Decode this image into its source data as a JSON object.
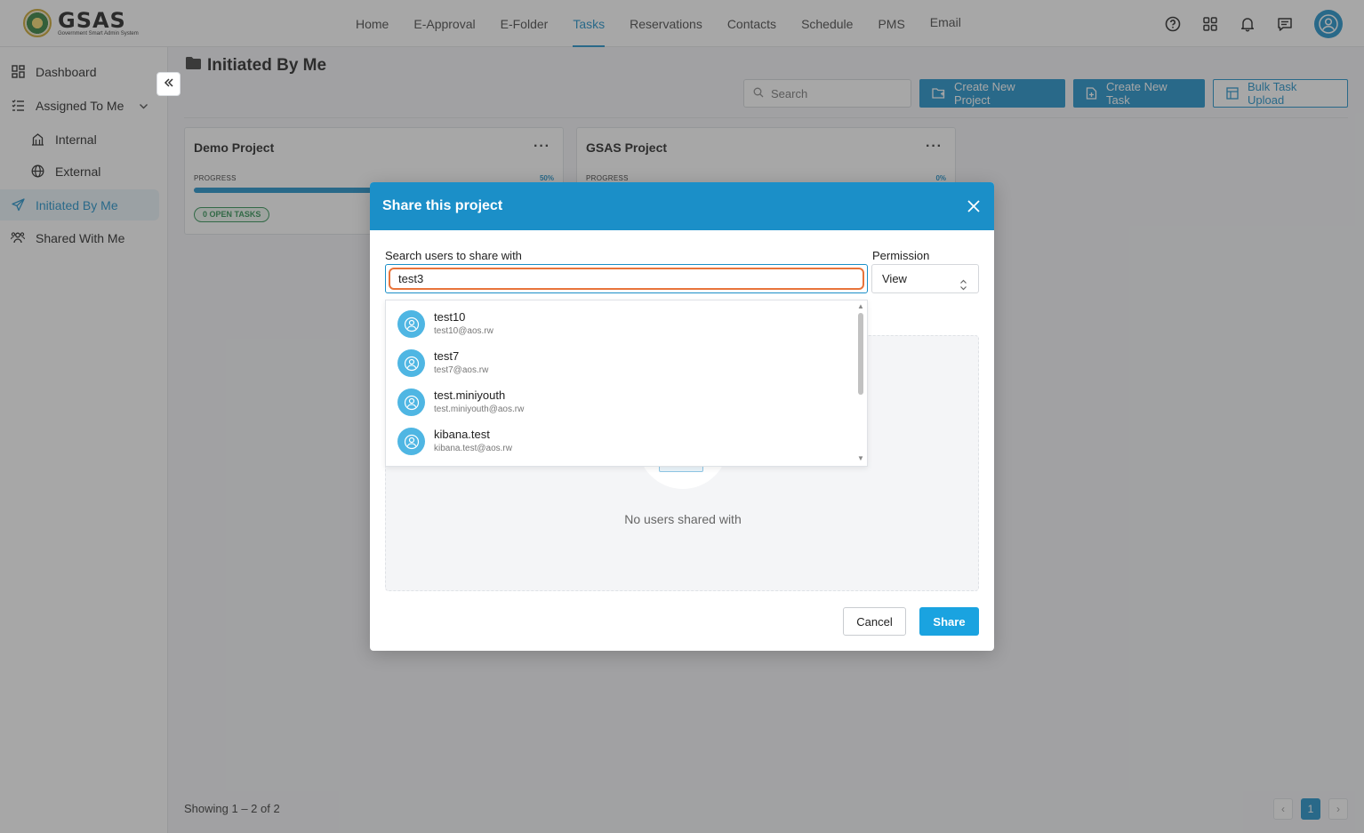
{
  "header": {
    "logo_word": "GSAS",
    "logo_subtitle": "Government Smart Admin System",
    "nav": [
      "Home",
      "E-Approval",
      "E-Folder",
      "Tasks",
      "Reservations",
      "Contacts",
      "Schedule",
      "PMS",
      "Email"
    ],
    "active_nav": "Tasks",
    "icons": [
      "help-icon",
      "apps-grid-icon",
      "bell-icon",
      "chat-icon",
      "user-avatar-icon"
    ]
  },
  "sidebar": {
    "items": [
      {
        "label": "Dashboard",
        "icon": "dashboard-icon"
      },
      {
        "label": "Assigned To Me",
        "icon": "list-check-icon"
      },
      {
        "label": "Internal",
        "icon": "building-icon"
      },
      {
        "label": "External",
        "icon": "globe-icon"
      },
      {
        "label": "Initiated By Me",
        "icon": "send-icon"
      },
      {
        "label": "Shared With Me",
        "icon": "users-icon"
      }
    ],
    "active": "Initiated By Me"
  },
  "main": {
    "title": "Initiated By Me",
    "search_placeholder": "Search",
    "buttons": {
      "create_project": "Create New Project",
      "create_task": "Create New Task",
      "bulk_upload": "Bulk Task Upload"
    },
    "cards": [
      {
        "title": "Demo Project",
        "progress_label": "PROGRESS",
        "progress_text": "50%",
        "progress": 0.5,
        "open_tasks": "0 OPEN TASKS"
      },
      {
        "title": "GSAS Project",
        "progress_label": "PROGRESS",
        "progress_text": "0%",
        "progress": 0.0
      }
    ],
    "card_menu": "···",
    "footer": "Showing 1 – 2 of 2",
    "pager": {
      "prev": "‹",
      "current": "1",
      "next": "›"
    }
  },
  "modal": {
    "title": "Share this project",
    "search_label": "Search users to share with",
    "search_value": "test3",
    "permission_label": "Permission",
    "permission_value": "View",
    "suggestions": [
      {
        "name": "test10",
        "email": "test10@aos.rw"
      },
      {
        "name": "test7",
        "email": "test7@aos.rw"
      },
      {
        "name": "test.miniyouth",
        "email": "test.miniyouth@aos.rw"
      },
      {
        "name": "kibana.test",
        "email": "kibana.test@aos.rw"
      }
    ],
    "empty_text": "No users shared with",
    "cancel": "Cancel",
    "share": "Share"
  },
  "colors": {
    "accent": "#1b8fc8",
    "share_button": "#1aa3e0",
    "focus_ring": "#e8743b",
    "open_tasks": "#2a8f4f"
  }
}
